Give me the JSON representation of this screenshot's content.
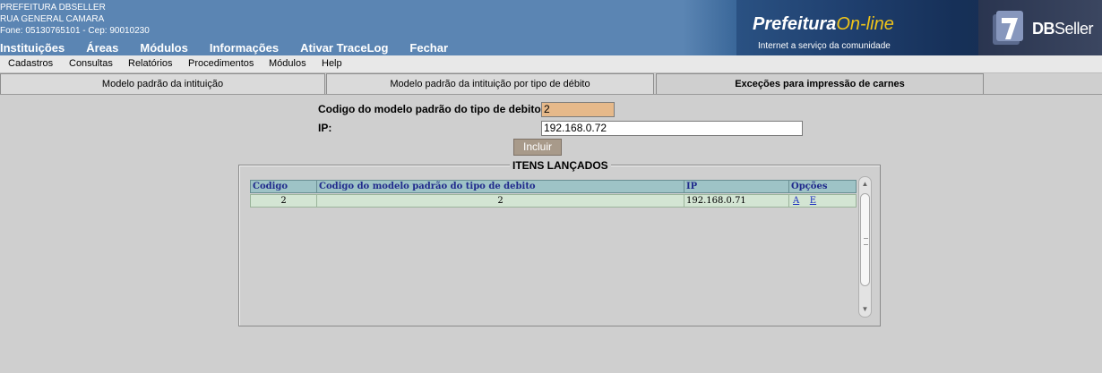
{
  "header": {
    "org_name": "PREFEITURA DBSELLER",
    "org_address": "RUA GENERAL CAMARA",
    "org_contact": "Fone: 05130765101  -  Cep: 90010230",
    "nav": [
      "Instituições",
      "Áreas",
      "Módulos",
      "Informações",
      "Ativar TraceLog",
      "Fechar"
    ],
    "brand_title_main": "Prefeitura",
    "brand_title_accent": "On-line",
    "brand_subtitle": "Internet a serviço da comunidade",
    "vendor_bold": "DB",
    "vendor_light": "Seller"
  },
  "menubar": [
    "Cadastros",
    "Consultas",
    "Relatórios",
    "Procedimentos",
    "Módulos",
    "Help"
  ],
  "tabs": [
    {
      "label": "Modelo padrão da intituição",
      "active": false
    },
    {
      "label": "Modelo padrão da intituição por tipo de débito",
      "active": false
    },
    {
      "label": "Exceções para impressão de carnes",
      "active": true
    }
  ],
  "form": {
    "codigo_label": "Codigo do modelo padrão do tipo de debito:",
    "codigo_value": "2",
    "ip_label": "IP:",
    "ip_value": "192.168.0.72",
    "submit_label": "Incluir"
  },
  "grid": {
    "legend": "ITENS LANÇADOS",
    "columns": [
      "Codigo",
      "Codigo do modelo padrão do tipo de debito",
      "IP",
      "Opções"
    ],
    "rows": [
      {
        "codigo": "2",
        "modelo": "2",
        "ip": "192.168.0.71",
        "opt_alterar": "A",
        "opt_excluir": "E"
      }
    ]
  },
  "colors": {
    "header_bg": "#5b85b3",
    "codigo_input_bg": "#e6b98a",
    "table_header_bg": "#9ec3c6",
    "table_row_bg": "#d3e5d3",
    "button_bg": "#a89a8a"
  }
}
